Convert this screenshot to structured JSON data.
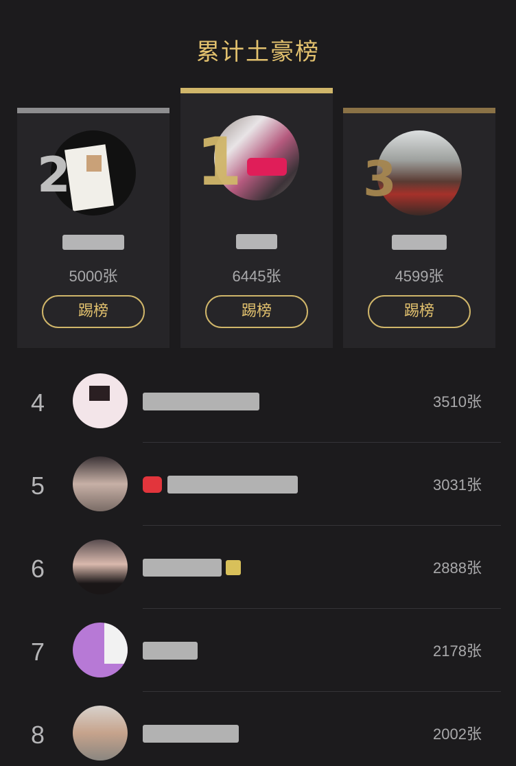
{
  "header": {
    "title": "累计土豪榜"
  },
  "podium": [
    {
      "rank": "2",
      "count": "5000张",
      "button": "踢榜"
    },
    {
      "rank": "1",
      "count": "6445张",
      "button": "踢榜"
    },
    {
      "rank": "3",
      "count": "4599张",
      "button": "踢榜"
    }
  ],
  "list": [
    {
      "rank": "4",
      "count": "3510张"
    },
    {
      "rank": "5",
      "count": "3031张"
    },
    {
      "rank": "6",
      "count": "2888张"
    },
    {
      "rank": "7",
      "count": "2178张"
    },
    {
      "rank": "8",
      "count": "2002张"
    }
  ]
}
